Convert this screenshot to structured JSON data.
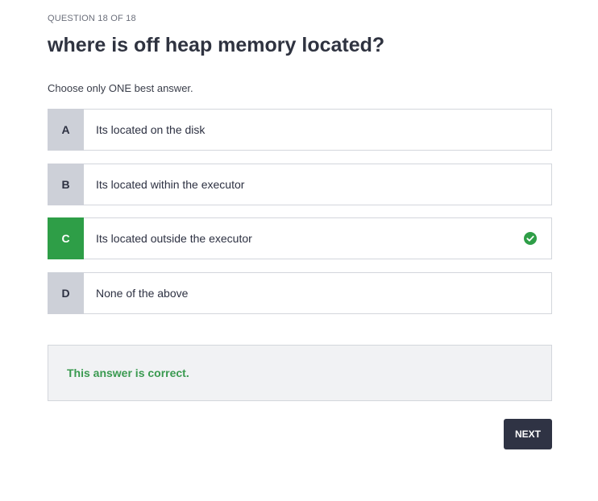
{
  "quiz": {
    "progress": "QUESTION 18 OF 18",
    "question": "where is off heap memory located?",
    "instruction": "Choose only ONE best answer.",
    "options": [
      {
        "letter": "A",
        "text": "Its located on the disk"
      },
      {
        "letter": "B",
        "text": "Its located within the executor"
      },
      {
        "letter": "C",
        "text": "Its located outside the executor",
        "correct": true
      },
      {
        "letter": "D",
        "text": "None of the above"
      }
    ],
    "feedback": "This answer is correct.",
    "next_label": "NEXT"
  },
  "colors": {
    "correct": "#2e9e47",
    "letter_bg": "#cdd0d8",
    "button_bg": "#2f3344"
  },
  "icons": {
    "selected_option": "check-circle-icon"
  }
}
